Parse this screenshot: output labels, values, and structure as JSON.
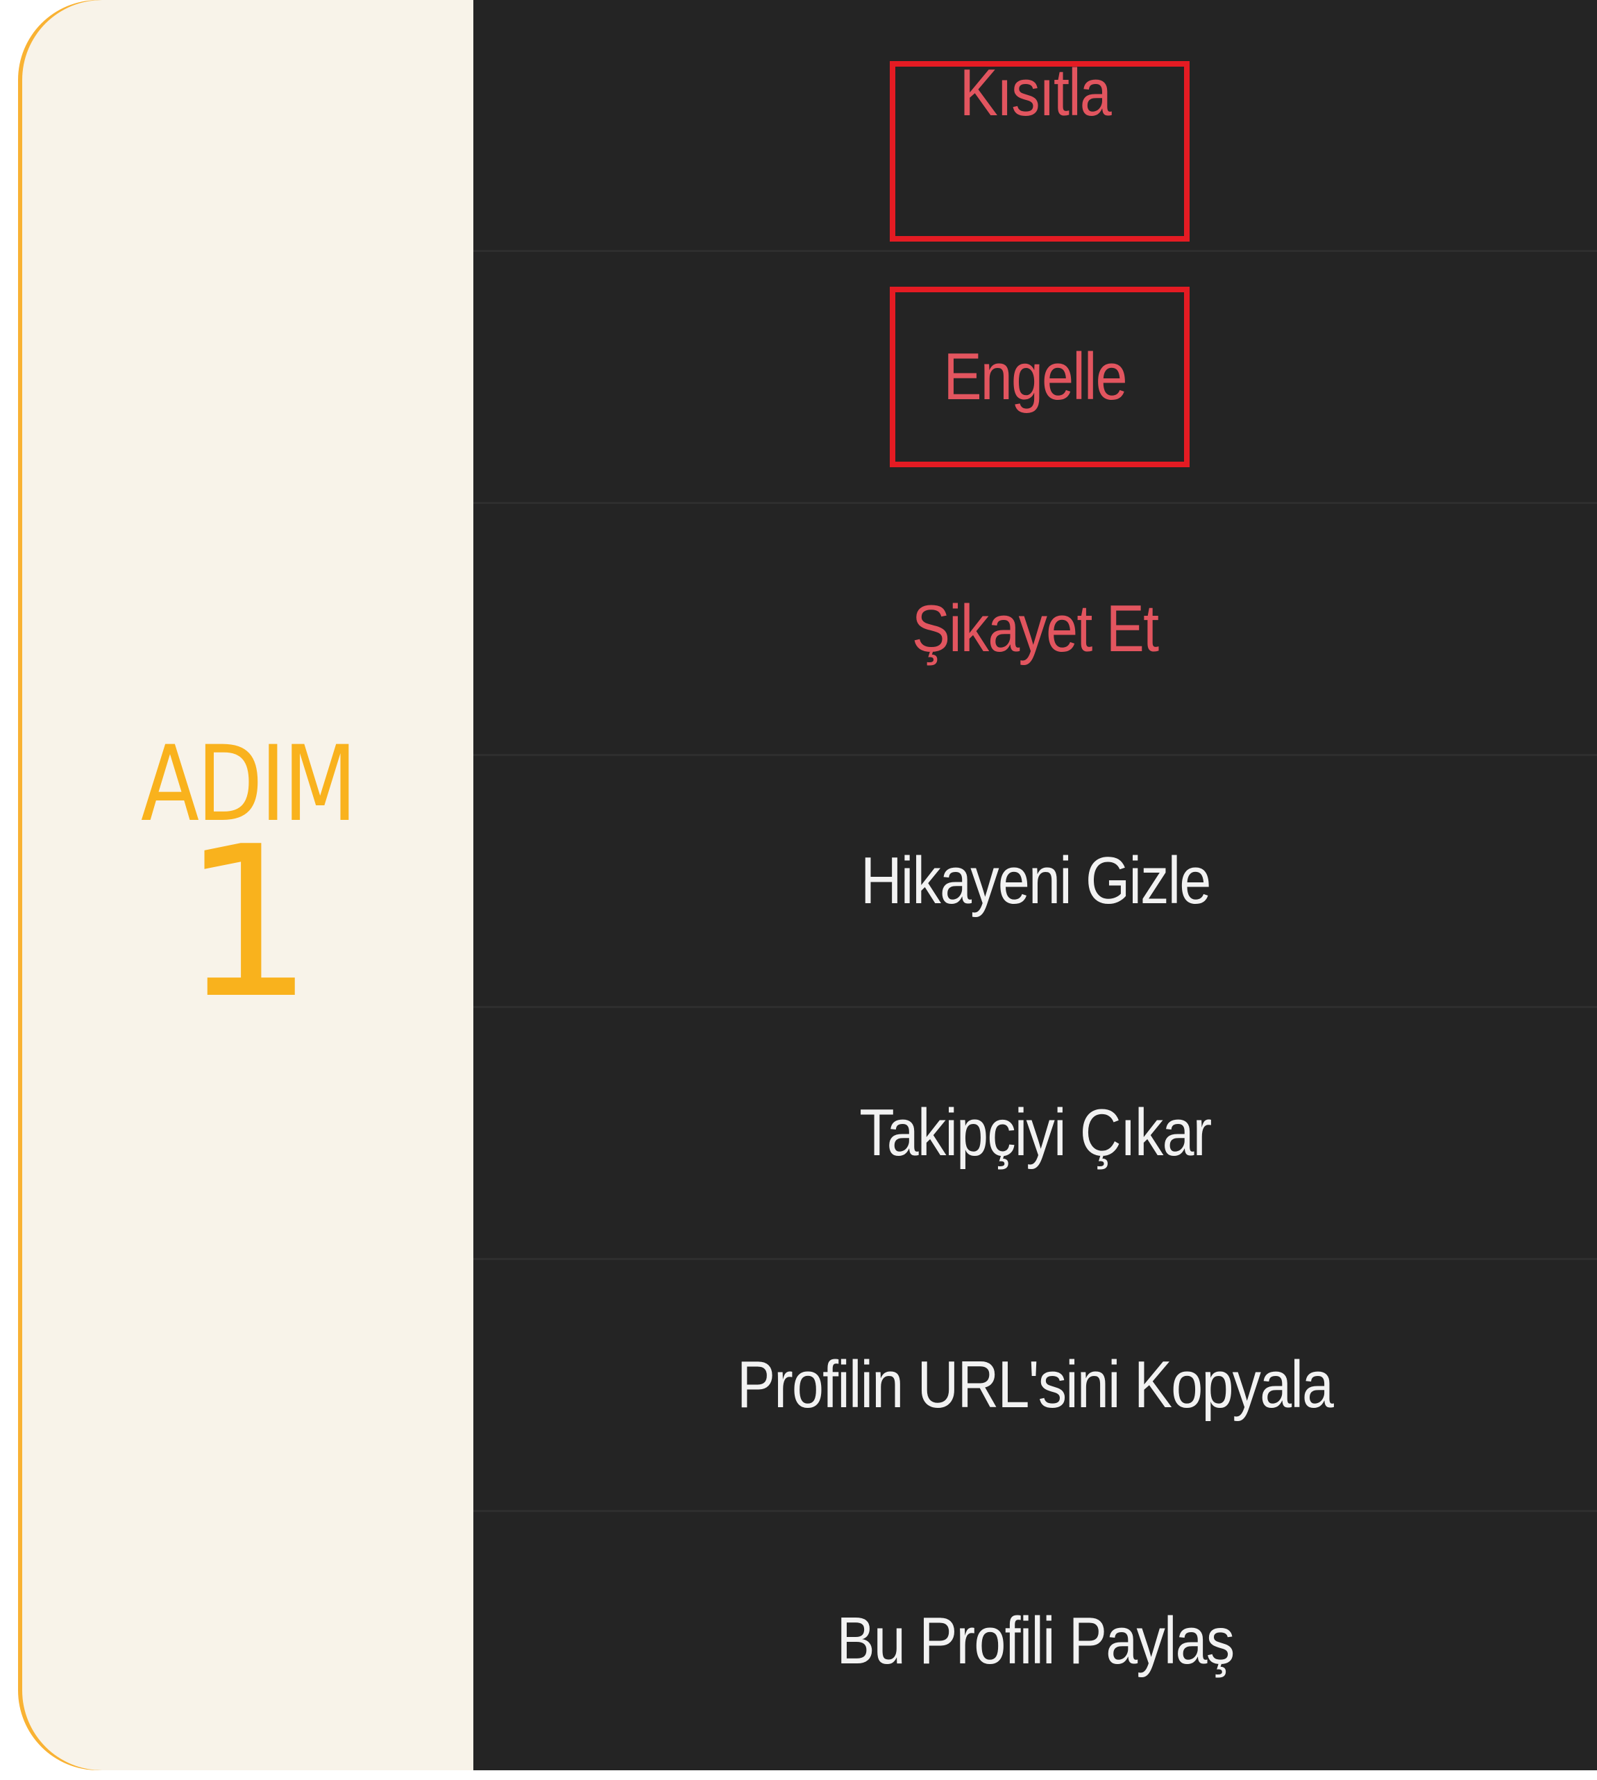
{
  "step": {
    "label": "ADIM",
    "number": "1"
  },
  "menu": {
    "items": [
      {
        "label": "Kısıtla",
        "tone": "danger",
        "highlighted": true
      },
      {
        "label": "Engelle",
        "tone": "danger",
        "highlighted": true
      },
      {
        "label": "Şikayet Et",
        "tone": "danger",
        "highlighted": false
      },
      {
        "label": "Hikayeni Gizle",
        "tone": "normal",
        "highlighted": false
      },
      {
        "label": "Takipçiyi Çıkar",
        "tone": "normal",
        "highlighted": false
      },
      {
        "label": "Profilin URL'sini Kopyala",
        "tone": "normal",
        "highlighted": false
      },
      {
        "label": "Bu Profili Paylaş",
        "tone": "normal",
        "highlighted": false
      }
    ]
  },
  "colors": {
    "accent": "#f9b21d",
    "panel_background": "#f8f3e9",
    "menu_background": "#242424",
    "danger_text": "#e2555f",
    "normal_text": "#f2f2f2",
    "highlight_border": "#e41b23"
  }
}
